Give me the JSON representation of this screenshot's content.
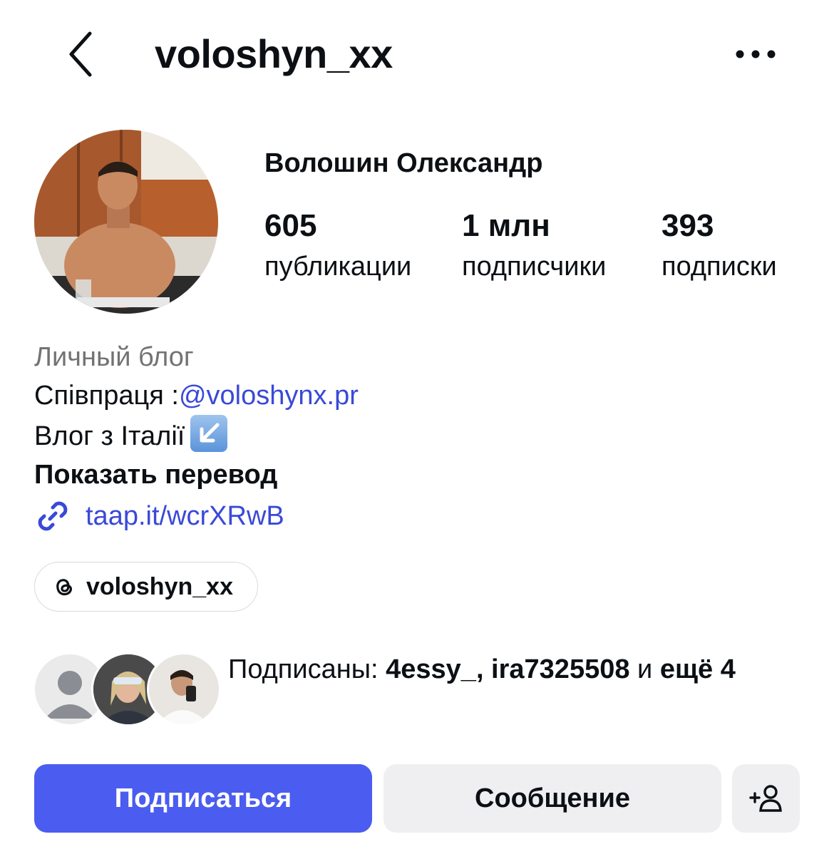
{
  "header": {
    "username": "voloshyn_xx",
    "back_icon": "chevron-left-icon",
    "more_icon": "more-horizontal-icon"
  },
  "profile": {
    "full_name": "Волошин Олександр",
    "stats": [
      {
        "value": "605",
        "label": "публикации"
      },
      {
        "value": "1 млн",
        "label": "подписчики"
      },
      {
        "value": "393",
        "label": "подписки"
      }
    ]
  },
  "bio": {
    "category": "Личный блог",
    "line1_prefix": "Співпраця :",
    "line1_mention": "@voloshynx.pr",
    "line2": "Влог з Італії",
    "line2_emoji": "↙️",
    "translate": "Показать перевод",
    "link": "taap.it/wcrXRwB",
    "link_icon": "link-icon"
  },
  "threads": {
    "label": "voloshyn_xx",
    "icon": "threads-icon"
  },
  "followed_by": {
    "prefix": "Подписаны: ",
    "names": "4essy_, ira7325508",
    "and": " и ",
    "more": "ещё 4"
  },
  "actions": {
    "follow": "Подписаться",
    "message": "Сообщение",
    "add_icon": "add-person-icon"
  },
  "colors": {
    "accent": "#4b5cf0",
    "link": "#3a49d8",
    "secondary_button": "#efeff2",
    "muted_text": "#737373"
  }
}
